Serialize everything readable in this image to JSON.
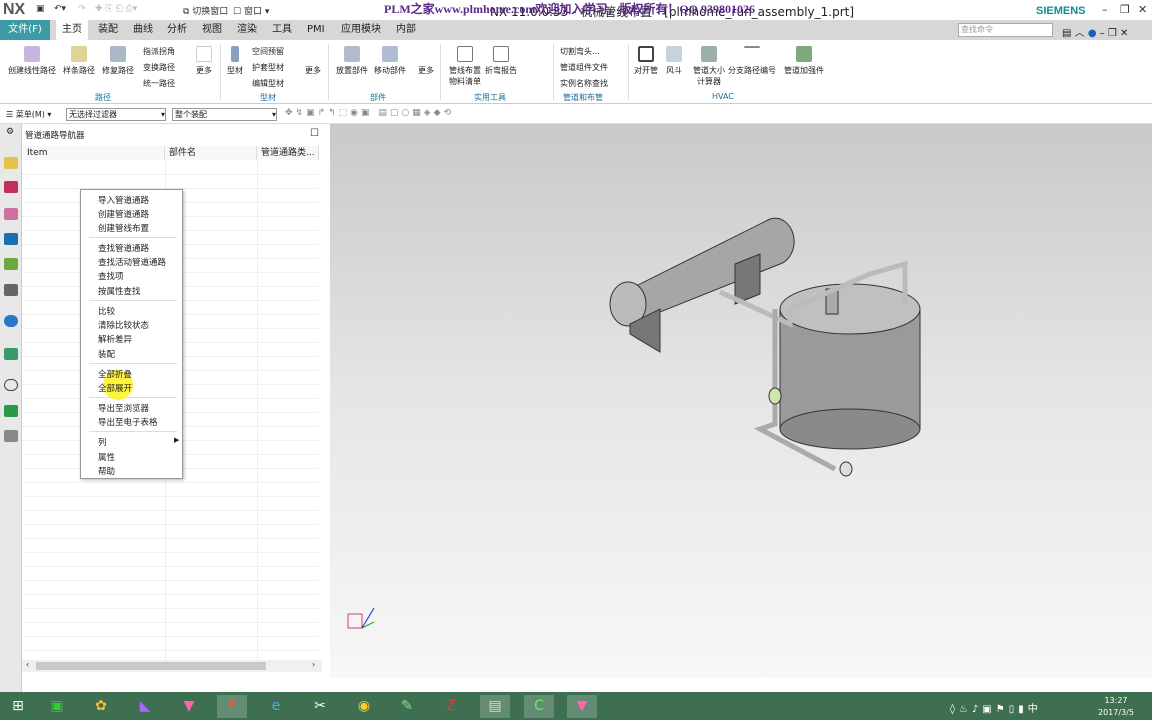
{
  "titlebar": {
    "logo": "NX",
    "title": "NX 11.0.0.33 - 机械管线布置 - [plmhome_run_assembly_1.prt]",
    "watermark": "PLM之家www.plmhome.com欢迎加入学习，版权所有！QQ 939801026",
    "brand": "SIEMENS",
    "switch_window": "切换窗口",
    "window": "窗口"
  },
  "tabs": {
    "file": "文件(F)",
    "items": [
      "主页",
      "装配",
      "曲线",
      "分析",
      "视图",
      "渲染",
      "工具",
      "PMI",
      "应用模块",
      "内部"
    ],
    "search_placeholder": "查找命令"
  },
  "ribbon": {
    "buttons": [
      "创建线性路径",
      "样条路径",
      "修复路径"
    ],
    "small1": [
      "指派拐角",
      "变换路径",
      "统一路径"
    ],
    "more": "更多",
    "stock": "型材",
    "small2": [
      "空间预留",
      "护套型材",
      "编辑型材"
    ],
    "parts": [
      "放置部件",
      "移动部件"
    ],
    "util": [
      "管线布置物料清单",
      "折弯报告"
    ],
    "small3": [
      "切割弯头...",
      "管道组件文件",
      "实例名称查找"
    ],
    "hvac": [
      "对开管",
      "风斗",
      "管道大小计算器",
      "分支路径编号",
      "管道加强件"
    ],
    "groups": [
      "路径",
      "型材",
      "部件",
      "实用工具",
      "管道和布管",
      "HVAC"
    ]
  },
  "toolbar": {
    "menu": "菜单(M)",
    "filter": "无选择过滤器",
    "scope": "整个装配"
  },
  "navigator": {
    "title": "管道通路导航器",
    "columns": [
      "Item",
      "部件名",
      "管道通路类..."
    ]
  },
  "context_menu": {
    "groups": [
      [
        "导入管道通路",
        "创建管道通路",
        "创建管线布置"
      ],
      [
        "查找管道通路",
        "查找活动管道通路",
        "查找项",
        "按属性查找"
      ],
      [
        "比较",
        "清除比较状态",
        "解析差异",
        "装配"
      ],
      [
        "全部折叠",
        "全部展开"
      ],
      [
        "导出至浏览器",
        "导出至电子表格"
      ],
      [
        "列",
        "属性",
        "帮助"
      ]
    ]
  },
  "taskbar": {
    "time": "13:27",
    "date": "2017/3/5"
  }
}
